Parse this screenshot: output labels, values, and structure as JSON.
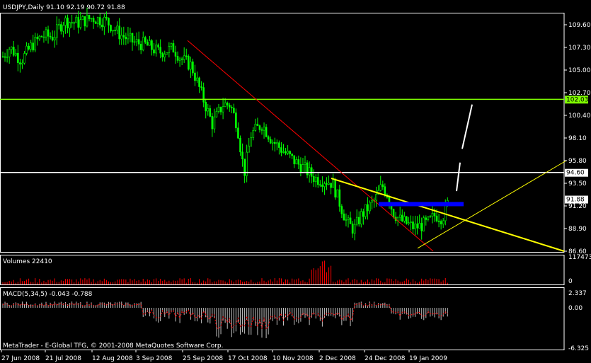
{
  "main": {
    "header": "USDJPY,Daily  91.10 92.19 90.72 91.88",
    "price_ticks": [
      "109.60",
      "107.30",
      "105.00",
      "102.70",
      "100.40",
      "98.10",
      "95.80",
      "93.50",
      "91.20",
      "88.90",
      "86.60"
    ],
    "price_range": [
      85.5,
      111.0
    ],
    "hlines": [
      {
        "label": "102.03",
        "value": 102.03,
        "color": "#7fff00"
      },
      {
        "label": "94.60",
        "value": 94.6,
        "color": "#ffffff"
      }
    ],
    "current": {
      "label": "91.88",
      "value": 91.88
    }
  },
  "volumes": {
    "label": "Volumes 22410",
    "ticks": [
      "117473",
      "0"
    ],
    "max": 117473
  },
  "macd": {
    "label": "MACD(5,34,5) -0.043 -0.788",
    "ticks": [
      "2.337",
      "0.00",
      "-6.325"
    ],
    "range": [
      -6.325,
      2.337
    ]
  },
  "dates": [
    "27 Jun 2008",
    "21 Jul 2008",
    "12 Aug 2008",
    "3 Sep 2008",
    "25 Sep 2008",
    "17 Oct 2008",
    "10 Nov 2008",
    "2 Dec 2008",
    "24 Dec 2008",
    "19 Jan 2009"
  ],
  "copyright": "MetaTrader - E-Global TFG, © 2001-2008 MetaQuotes Software Corp.",
  "colors": {
    "bull": "#00ff00",
    "bear": "#00ff00",
    "volume": "#ff0000",
    "macd_hist": "#c0c0c0",
    "macd_signal": "#ff0000",
    "grid": "#808080",
    "channel": "#ff0000",
    "trend": "#ffff00",
    "fib_band": "#0000ff",
    "projection": "#ffffff"
  },
  "chart_data": {
    "type": "candlestick",
    "symbol": "USDJPY",
    "timeframe": "Daily",
    "last_bar": {
      "open": 91.1,
      "high": 92.19,
      "low": 90.72,
      "close": 91.88
    },
    "x_dates": [
      "27 Jun 2008",
      "21 Jul 2008",
      "12 Aug 2008",
      "3 Sep 2008",
      "25 Sep 2008",
      "17 Oct 2008",
      "10 Nov 2008",
      "2 Dec 2008",
      "24 Dec 2008",
      "19 Jan 2009"
    ],
    "close_path": [
      [
        "27 Jun 2008",
        106.3
      ],
      [
        "21 Jul 2008",
        106.9
      ],
      [
        "12 Aug 2008",
        109.8
      ],
      [
        "3 Sep 2008",
        108.1
      ],
      [
        "25 Sep 2008",
        105.8
      ],
      [
        "17 Oct 2008",
        98.5
      ],
      [
        "10 Nov 2008",
        97.5
      ],
      [
        "2 Dec 2008",
        93.2
      ],
      [
        "24 Dec 2008",
        90.3
      ],
      [
        "19 Jan 2009",
        89.6
      ]
    ],
    "ylim": [
      86.6,
      109.6
    ]
  }
}
